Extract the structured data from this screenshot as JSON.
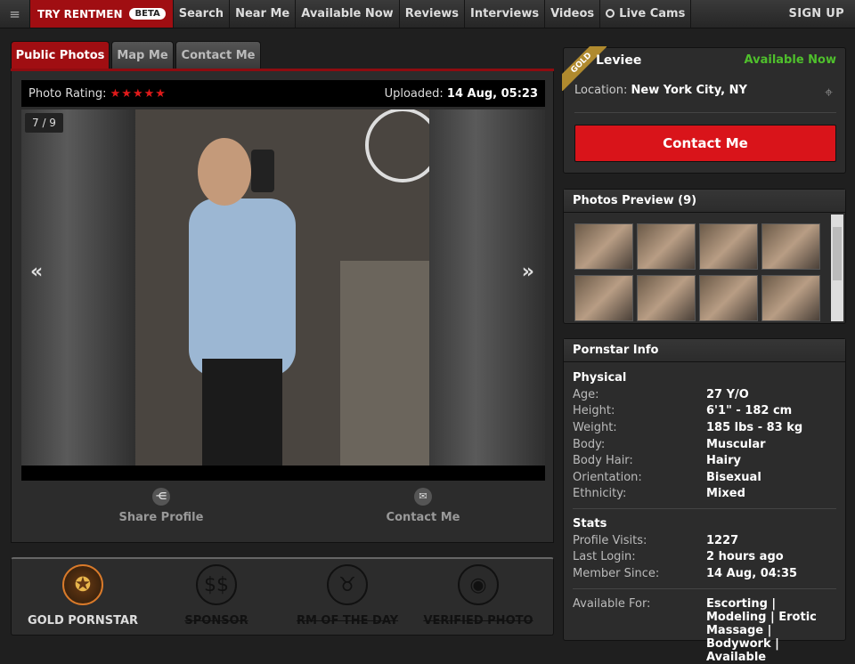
{
  "nav": {
    "menu_icon": "hamburger-icon",
    "brand": "TRY RENTMEN",
    "beta": "BETA",
    "items": [
      "Search",
      "Near Me",
      "Available Now",
      "Reviews",
      "Interviews",
      "Videos",
      "Live Cams"
    ],
    "live_cams_icon": "pin-icon",
    "signup": "SIGN UP"
  },
  "tabs": [
    "Public Photos",
    "Map Me",
    "Contact Me"
  ],
  "photo": {
    "rating_label": "Photo Rating:",
    "stars": "★★★★★",
    "uploaded_label": "Uploaded:",
    "uploaded_value": "14 Aug, 05:23",
    "counter": "7 / 9",
    "prev": "«",
    "next": "»"
  },
  "actions": {
    "share_label": "Share Profile",
    "share_icon": "share-icon",
    "contact_label": "Contact Me",
    "contact_icon": "envelope-icon"
  },
  "badges": [
    {
      "label": "GOLD PORNSTAR",
      "icon": "award-icon",
      "active": true
    },
    {
      "label": "SPONSOR",
      "icon": "dollar-icon",
      "active": false
    },
    {
      "label": "RM OF THE DAY",
      "icon": "bull-icon",
      "active": false
    },
    {
      "label": "VERIFIED PHOTO",
      "icon": "camera-icon",
      "active": false
    }
  ],
  "profile": {
    "ribbon": "GOLD",
    "name": "Leviee",
    "availability": "Available Now",
    "availability_color": "#4fc02c",
    "location_label": "Location:",
    "location_value": "New York City, NY",
    "map_icon": "map-marker-icon",
    "contact_button": "Contact Me",
    "accent": "#d9141a"
  },
  "preview": {
    "title": "Photos Preview (9)"
  },
  "info": {
    "title": "Pornstar Info",
    "physical_title": "Physical",
    "physical": [
      {
        "k": "Age:",
        "v": "27 Y/O"
      },
      {
        "k": "Height:",
        "v": "6'1\" - 182 cm"
      },
      {
        "k": "Weight:",
        "v": "185 lbs - 83 kg"
      },
      {
        "k": "Body:",
        "v": "Muscular"
      },
      {
        "k": "Body Hair:",
        "v": "Hairy"
      },
      {
        "k": "Orientation:",
        "v": "Bisexual"
      },
      {
        "k": "Ethnicity:",
        "v": "Mixed"
      }
    ],
    "stats_title": "Stats",
    "stats": [
      {
        "k": "Profile Visits:",
        "v": "1227"
      },
      {
        "k": "Last Login:",
        "v": "2 hours ago"
      },
      {
        "k": "Member Since:",
        "v": "14 Aug, 04:35"
      }
    ],
    "available_for_label": "Available For:",
    "available_for_value": "Escorting | Modeling | Erotic Massage | Bodywork | Available"
  }
}
